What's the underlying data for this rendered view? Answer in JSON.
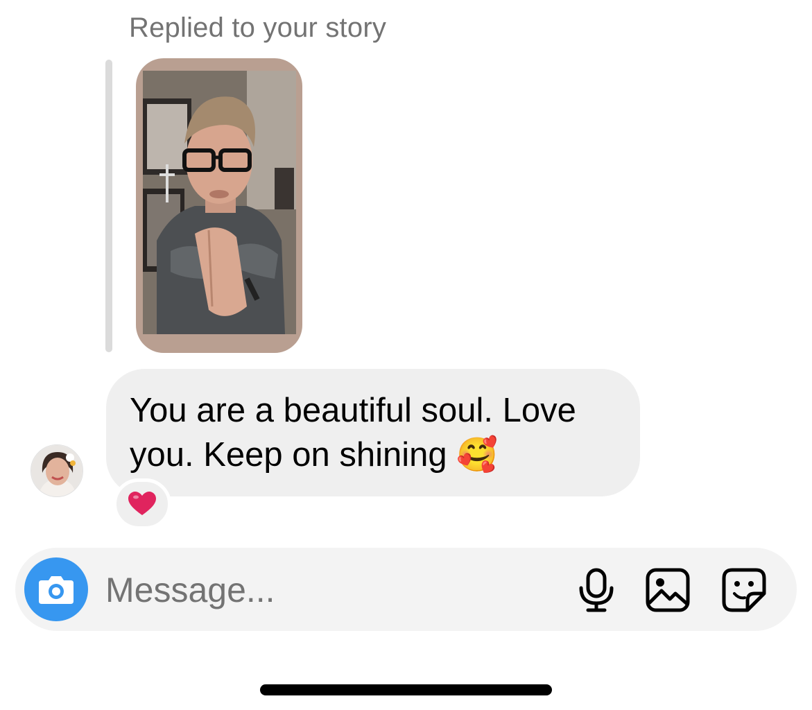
{
  "thread": {
    "reply_context_label": "Replied to your story",
    "message_text": "You are a beautiful soul. Love you. Keep on shining",
    "message_emoji": "🥰",
    "reaction_emoji": "❤️"
  },
  "composer": {
    "placeholder": "Message..."
  },
  "icons": {
    "camera": "camera-icon",
    "microphone": "microphone-icon",
    "gallery": "image-icon",
    "sticker": "sticker-icon"
  },
  "colors": {
    "accent": "#3797f0",
    "bubble": "#efefef",
    "secondary_text": "#737373",
    "composer_bg": "#f3f3f3",
    "heart": "#e0245e"
  }
}
